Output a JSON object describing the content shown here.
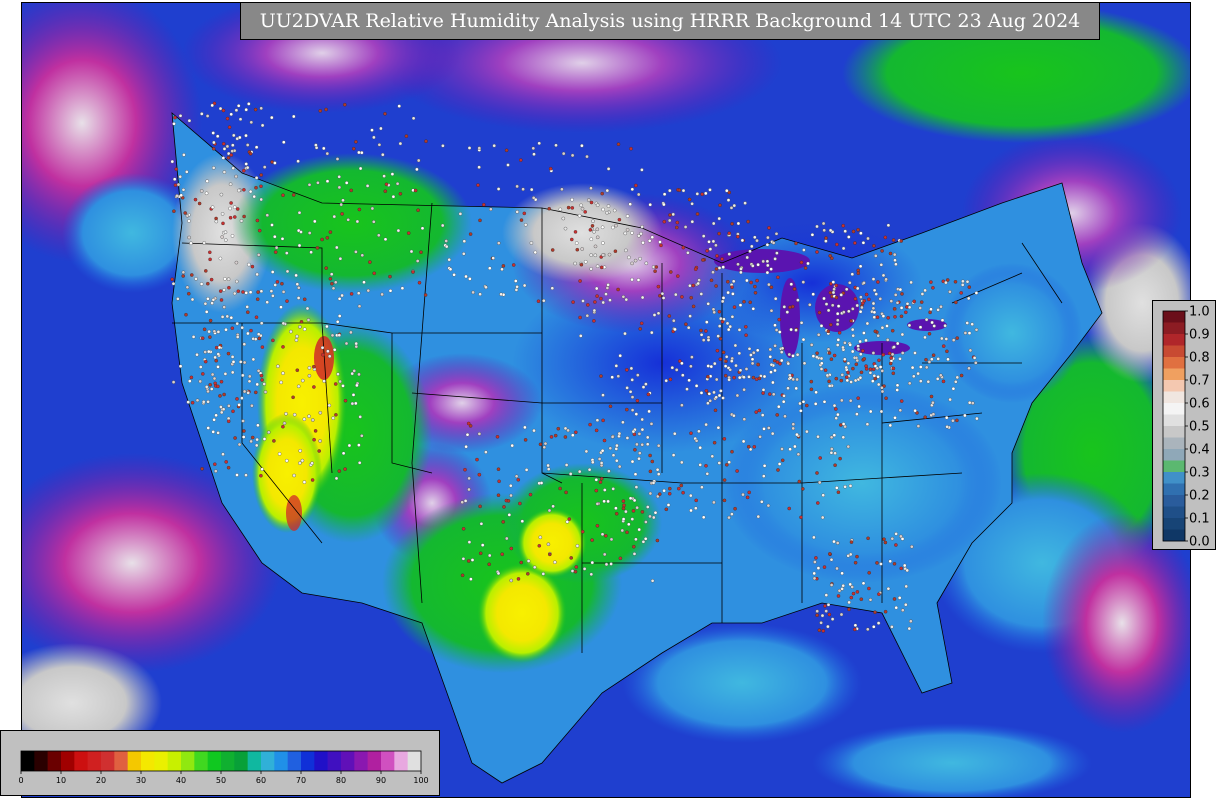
{
  "title": "UU2DVAR Relative Humidity Analysis using HRRR Background 14 UTC 23 Aug 2024",
  "colors": {
    "ocean": "#1f3fcf",
    "dry_yellow": "#f4e800",
    "green": "#17c41b",
    "cyan": "#3a9fe0",
    "purple": "#7a1fb0",
    "magenta": "#b0208f",
    "gray_moist": "#c8c8c8",
    "state_lines": "#000000"
  },
  "right_colorbar": {
    "labels": [
      "1.0",
      "0.9",
      "0.8",
      "0.7",
      "0.6",
      "0.5",
      "0.4",
      "0.3",
      "0.2",
      "0.1",
      "0.0"
    ],
    "colors": [
      "#6b0f1a",
      "#8c1c23",
      "#b0262a",
      "#c84a32",
      "#e07040",
      "#f0a060",
      "#f4c8b0",
      "#f0e6e0",
      "#f4f4f4",
      "#e0e0e0",
      "#c8c8c8",
      "#aab4bc",
      "#8fa8b8",
      "#5bb870",
      "#4090c8",
      "#3070b0",
      "#2a5c9c",
      "#1f4f88",
      "#174476",
      "#0f3766"
    ]
  },
  "bottom_colorbar": {
    "labels": [
      "0",
      "10",
      "20",
      "30",
      "40",
      "50",
      "60",
      "70",
      "80",
      "90",
      "100"
    ],
    "colors": [
      "#000000",
      "#2a0000",
      "#6a0000",
      "#a00000",
      "#cc1010",
      "#d02020",
      "#d03030",
      "#e06040",
      "#f4c800",
      "#f4e800",
      "#eaf000",
      "#c8f000",
      "#90e810",
      "#40d820",
      "#10c820",
      "#10b030",
      "#08a038",
      "#10b8a0",
      "#30b0d8",
      "#2090e8",
      "#2060e0",
      "#1030d8",
      "#2010c8",
      "#4010c0",
      "#6010b8",
      "#8a18b0",
      "#b020a0",
      "#d050c0",
      "#e8a8e0",
      "#e0e0e0"
    ]
  }
}
